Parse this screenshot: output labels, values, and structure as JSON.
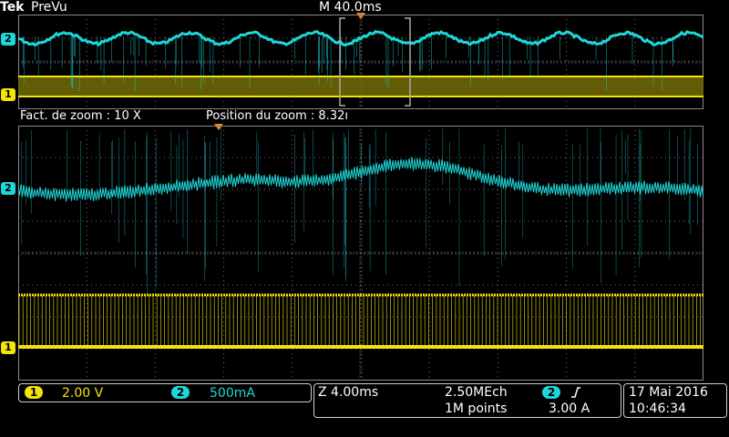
{
  "header": {
    "brand": "Tek",
    "mode": "PreVu",
    "timebase": "M 40.0ms"
  },
  "zoom_bar": {
    "factor": "Fact. de zoom : 10 X",
    "position": "Position du zoom  : 8.32ı"
  },
  "channels": {
    "ch1": {
      "badge": "1",
      "scale": "2.00 V",
      "color": "#f2e40b"
    },
    "ch2": {
      "badge": "2",
      "scale": "500mA",
      "color": "#1fd6d8"
    }
  },
  "acq": {
    "zoom_time": "Z 4.00ms",
    "sample_rate": "2.50MEch",
    "record": "1M points",
    "trigger_channel": "2",
    "trigger_icon": "rising-edge-icon",
    "trigger_level": "3.00 A"
  },
  "datetime": {
    "date": "17 Mai  2016",
    "time": "10:46:34"
  },
  "colors": {
    "grid": "#6f6f6f",
    "trigger_marker": "#f08a1c",
    "zoom_box": "#aaaaaa"
  }
}
